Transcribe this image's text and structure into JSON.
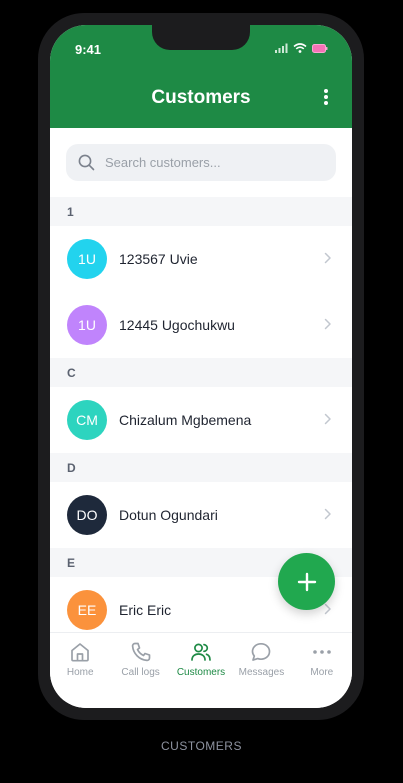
{
  "status": {
    "time": "9:41"
  },
  "header": {
    "title": "Customers"
  },
  "search": {
    "placeholder": "Search customers..."
  },
  "sections": [
    {
      "letter": "1",
      "customers": [
        {
          "initials": "1U",
          "name": "123567 Uvie",
          "color": "#22d3ee"
        },
        {
          "initials": "1U",
          "name": "12445 Ugochukwu",
          "color": "#c084fc"
        }
      ]
    },
    {
      "letter": "C",
      "customers": [
        {
          "initials": "CM",
          "name": "Chizalum Mgbemena",
          "color": "#2dd4bf"
        }
      ]
    },
    {
      "letter": "D",
      "customers": [
        {
          "initials": "DO",
          "name": "Dotun Ogundari",
          "color": "#1e293b"
        }
      ]
    },
    {
      "letter": "E",
      "customers": [
        {
          "initials": "EE",
          "name": "Eric Eric",
          "color": "#fb923c"
        }
      ]
    }
  ],
  "tabs": [
    {
      "label": "Home",
      "icon": "home-icon"
    },
    {
      "label": "Call logs",
      "icon": "phone-icon"
    },
    {
      "label": "Customers",
      "icon": "users-icon",
      "active": true
    },
    {
      "label": "Messages",
      "icon": "chat-icon"
    },
    {
      "label": "More",
      "icon": "more-icon"
    }
  ],
  "caption": "CUSTOMERS",
  "colors": {
    "brand": "#1e8a45",
    "fab": "#21a84f",
    "inactive": "#9aa0a8"
  }
}
